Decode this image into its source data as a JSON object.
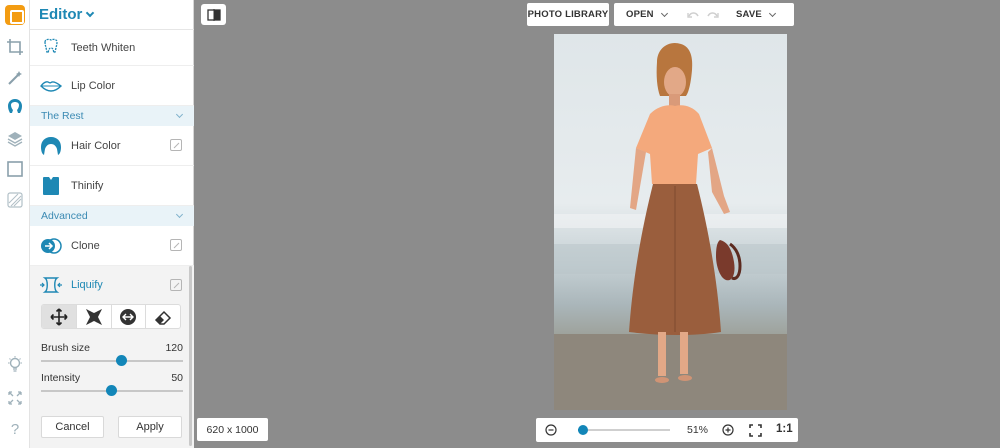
{
  "panel": {
    "title": "Editor",
    "tools_top": [
      {
        "label": "Teeth Whiten",
        "icon": "tooth-icon"
      },
      {
        "label": "Lip Color",
        "icon": "lips-icon"
      }
    ],
    "sections": [
      {
        "label": "The Rest"
      },
      {
        "label": "Advanced"
      }
    ],
    "tools_rest": [
      {
        "label": "Hair Color",
        "icon": "hair-icon"
      },
      {
        "label": "Thinify",
        "icon": "thinify-icon"
      }
    ],
    "tools_advanced": [
      {
        "label": "Clone",
        "icon": "clone-icon"
      }
    ],
    "liquify": {
      "label": "Liquify",
      "modes": [
        "move-icon",
        "shrink-icon",
        "bloat-icon",
        "eraser-icon"
      ],
      "active_mode": "move-icon",
      "brush_size_label": "Brush size",
      "brush_size_value": "120",
      "brush_size_fraction": 0.56,
      "intensity_label": "Intensity",
      "intensity_value": "50",
      "intensity_fraction": 0.49,
      "cancel_label": "Cancel",
      "apply_label": "Apply"
    }
  },
  "rail": {
    "icons": [
      "crop-icon",
      "magic-wand-icon",
      "face-icon",
      "layers-icon",
      "frame-icon",
      "texture-icon",
      "lightbulb-icon",
      "fullscreen-icon",
      "help-icon"
    ]
  },
  "toolbar": {
    "photo_library": "PHOTO LIBRARY",
    "open": "OPEN",
    "save": "SAVE"
  },
  "status": {
    "dimensions": "620 x 1000",
    "zoom_percent": "51%",
    "zoom_fraction": 0.05,
    "actual_size": "1:1"
  },
  "colors": {
    "accent": "#1286b8",
    "canvas_bg": "#8c8c8c",
    "section_bg": "#e9f3f8"
  }
}
